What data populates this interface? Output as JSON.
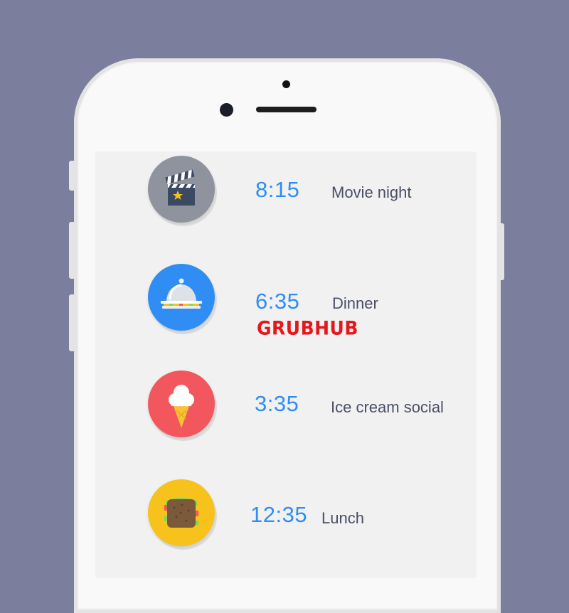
{
  "events": [
    {
      "time": "8:15",
      "label": "Movie night",
      "icon": "clapperboard-icon",
      "color": "#8e939d"
    },
    {
      "time": "6:35",
      "label": "Dinner",
      "icon": "cloche-icon",
      "color": "#2f8df3",
      "partner": "GRUBHUB"
    },
    {
      "time": "3:35",
      "label": "Ice cream social",
      "icon": "ice-cream-icon",
      "color": "#f2575d"
    },
    {
      "time": "12:35",
      "label": "Lunch",
      "icon": "sandwich-icon",
      "color": "#f6c21b"
    }
  ],
  "colors": {
    "background": "#7b7e9c",
    "time_text": "#2f8df3",
    "grubhub_red": "#e4171b"
  }
}
